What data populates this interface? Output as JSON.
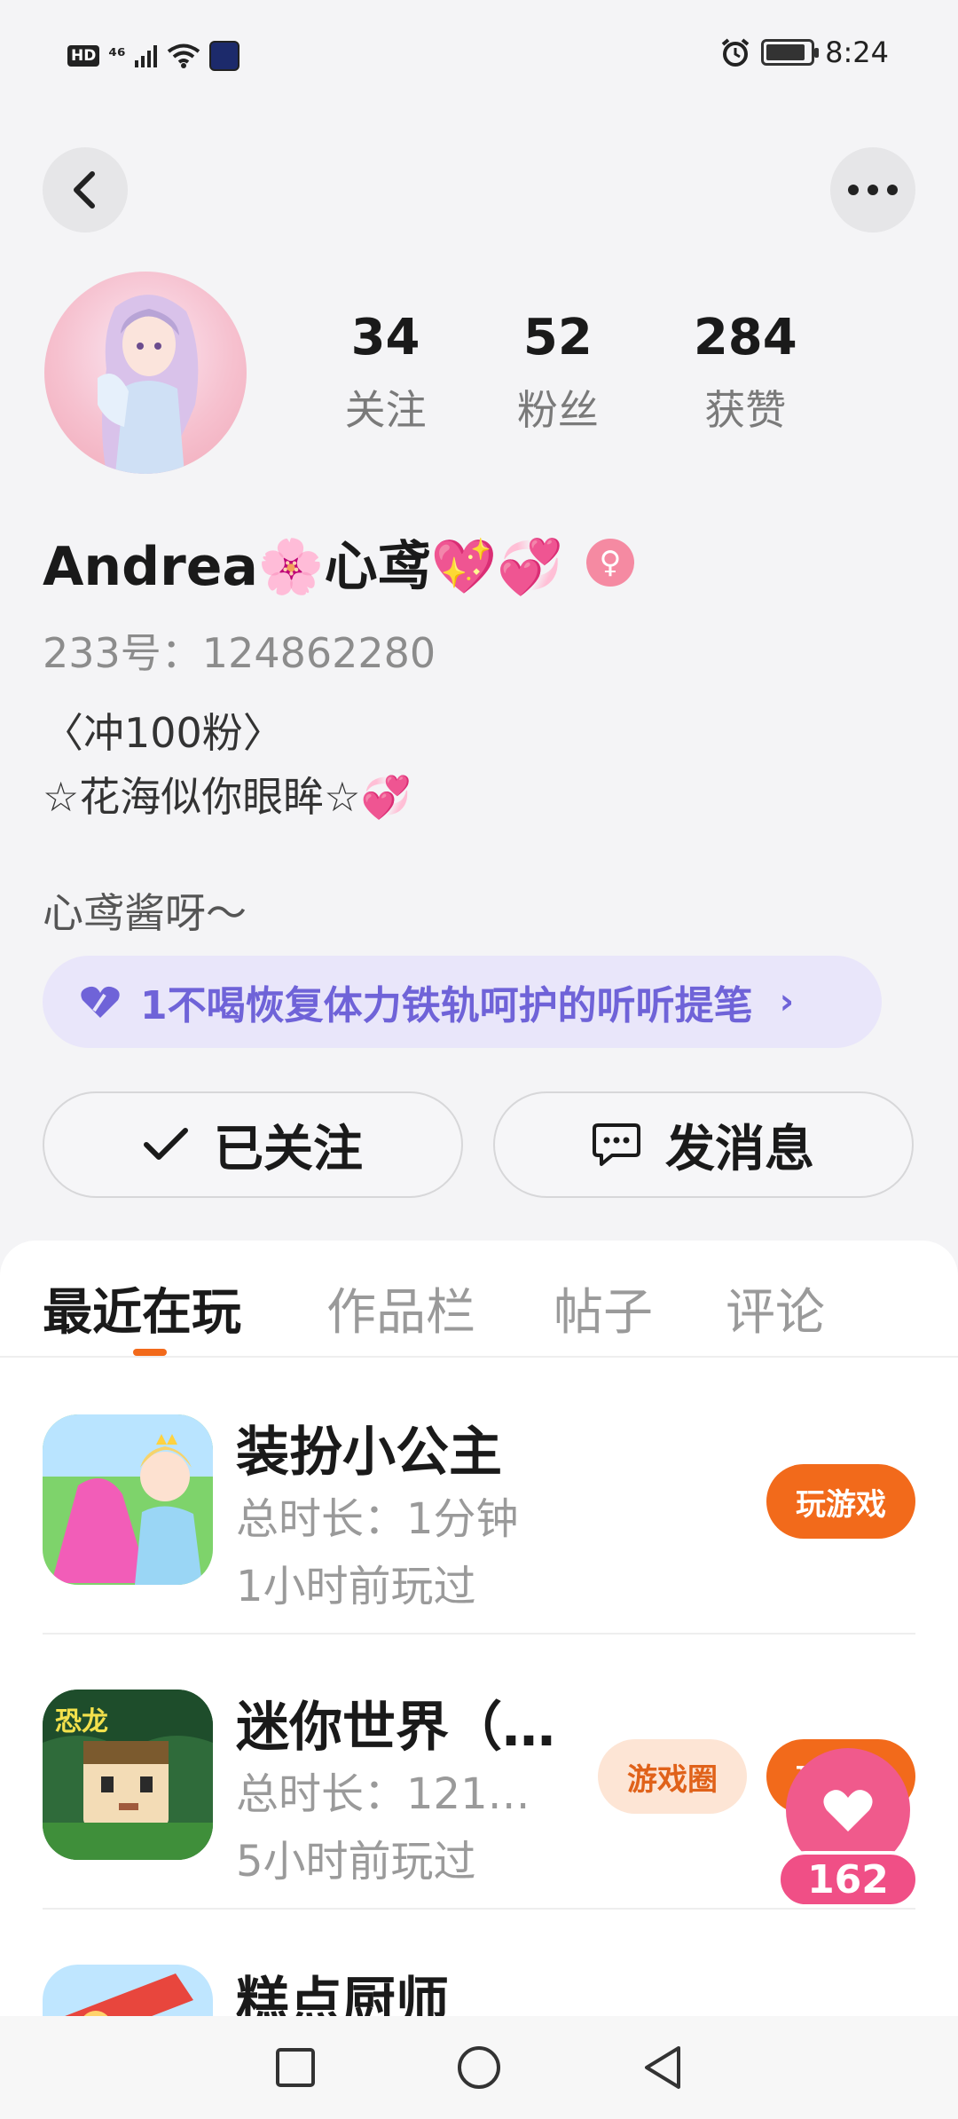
{
  "status_bar": {
    "hd": "HD",
    "signal": "⁴⁶",
    "time": "8:24",
    "battery_level": 0.9
  },
  "profile": {
    "stats": [
      {
        "value": "34",
        "label": "关注"
      },
      {
        "value": "52",
        "label": "粉丝"
      },
      {
        "value": "284",
        "label": "获赞"
      }
    ],
    "name": "Andrea🌸心鸢💖💞",
    "gender_symbol": "♀",
    "uid": "233号：124862280",
    "bio_line1": "〈冲100粉〉",
    "bio_line2": "☆花海似你眼眸☆💞",
    "bio_line3": "心鸢酱呀～",
    "fan_group": "1不喝恢复体力铁轨呵护的听听提笔",
    "follow_label": "已关注",
    "message_label": "发消息"
  },
  "tabs": [
    "最近在玩",
    "作品栏",
    "帖子",
    "评论"
  ],
  "games": [
    {
      "name": "装扮小公主",
      "duration": "总时长：1分钟",
      "last_played": "1小时前玩过",
      "play_label": "玩游戏"
    },
    {
      "name": "迷你世界（…",
      "duration": "总时长：121…",
      "last_played": "5小时前玩过",
      "circle_label": "游戏圈",
      "play_label": "玩游戏"
    },
    {
      "name": "糕点厨师"
    }
  ],
  "like_count": "162",
  "colors": {
    "accent": "#f26a1b",
    "pink": "#f05a8c",
    "fan_purple": "#6f63d8"
  }
}
